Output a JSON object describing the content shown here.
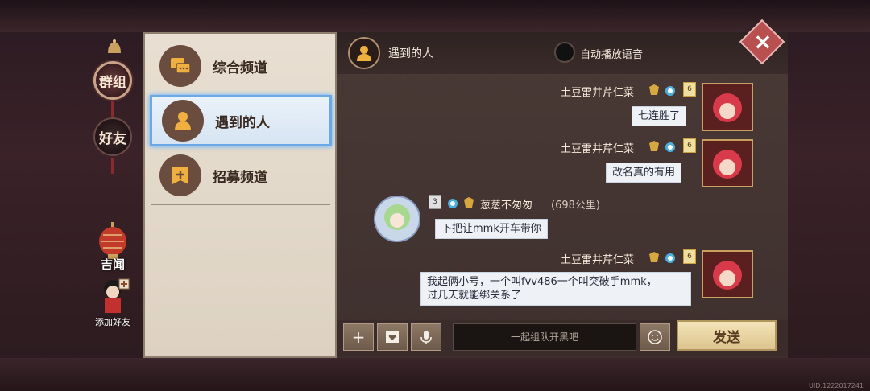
{
  "rail": {
    "group_label": "群组",
    "friends_label": "好友",
    "lantern_label": "吉闻",
    "add_friend_label": "添加好友"
  },
  "channels": [
    {
      "label": "综合频道",
      "icon": "chat-bubbles-icon"
    },
    {
      "label": "遇到的人",
      "icon": "person-icon"
    },
    {
      "label": "招募频道",
      "icon": "recruit-flag-icon"
    }
  ],
  "chat": {
    "title": "遇到的人",
    "auto_play_label": "自动播放语音",
    "messages": [
      {
        "sender": "土豆雷井芹仁菜",
        "level": "6",
        "text": "七连胜了",
        "side": "right"
      },
      {
        "sender": "土豆雷井芹仁菜",
        "level": "6",
        "text": "改名真的有用",
        "side": "right"
      },
      {
        "sender": "葱葱不匆匆",
        "level": "3",
        "distance": "(698公里)",
        "text": "下把让mmk开车带你",
        "side": "left"
      },
      {
        "sender": "土豆雷井芹仁菜",
        "level": "6",
        "text_lines": [
          "我起俩小号，一个叫fvv486一个叫突破手mmk，",
          "过几天就能绑关系了"
        ],
        "side": "right"
      }
    ]
  },
  "input": {
    "placeholder": "一起组队开黑吧",
    "send_label": "发送"
  },
  "uid": "UID:1222017241",
  "colors": {
    "accent_blue": "#6aa8e8",
    "panel_bg": "#e8dfd2",
    "send_gold": "#dcc48e"
  }
}
